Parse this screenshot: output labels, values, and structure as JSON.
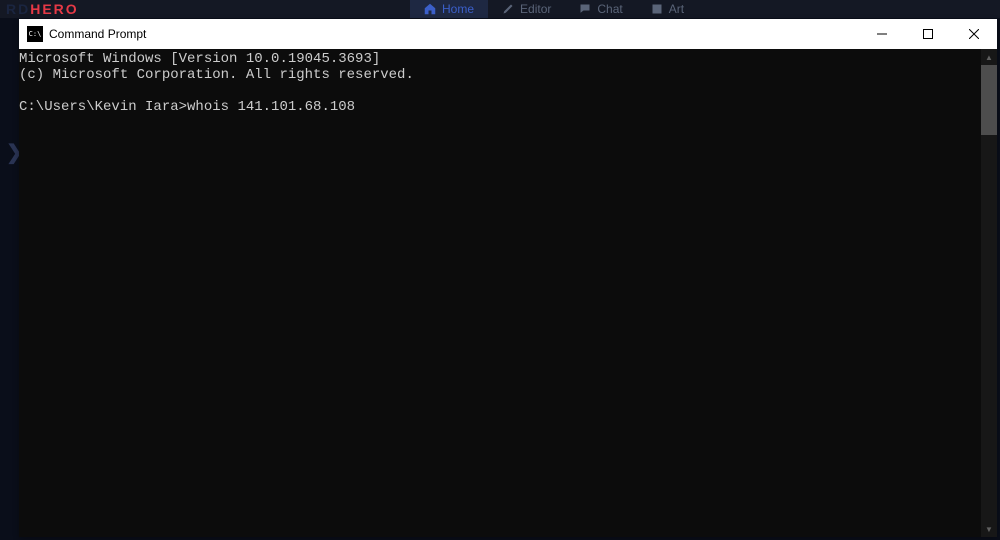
{
  "background": {
    "logo_part1": "RD",
    "logo_part2": "HERO",
    "prompt_symbol": "❯",
    "tabs": [
      {
        "label": "Home",
        "active": true
      },
      {
        "label": "Editor",
        "active": false
      },
      {
        "label": "Chat",
        "active": false
      },
      {
        "label": "Art",
        "active": false
      }
    ]
  },
  "window": {
    "title": "Command Prompt"
  },
  "terminal": {
    "line1": "Microsoft Windows [Version 10.0.19045.3693]",
    "line2": "(c) Microsoft Corporation. All rights reserved.",
    "blank": "",
    "prompt": "C:\\Users\\Kevin Iara>",
    "command": "whois 141.101.68.108"
  }
}
